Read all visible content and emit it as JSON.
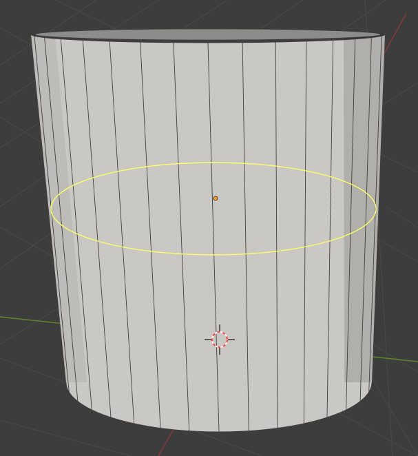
{
  "viewport": {
    "background": "#3d3d3d",
    "grid_color": "#4a4a4a",
    "x_axis_color": "#8a3a3a",
    "y_axis_color": "#5f8a2a"
  },
  "object": {
    "type": "cylinder",
    "segments": 32,
    "body_color": "#c9c8c4",
    "edge_color": "#3f3f3f",
    "selection": {
      "mode": "edge_loop",
      "color": "#ffff66"
    },
    "origin_color": "#ff9a1a"
  },
  "cursor": {
    "name": "3d-cursor",
    "ring_colors": [
      "#ff4040",
      "#ffffff"
    ]
  }
}
